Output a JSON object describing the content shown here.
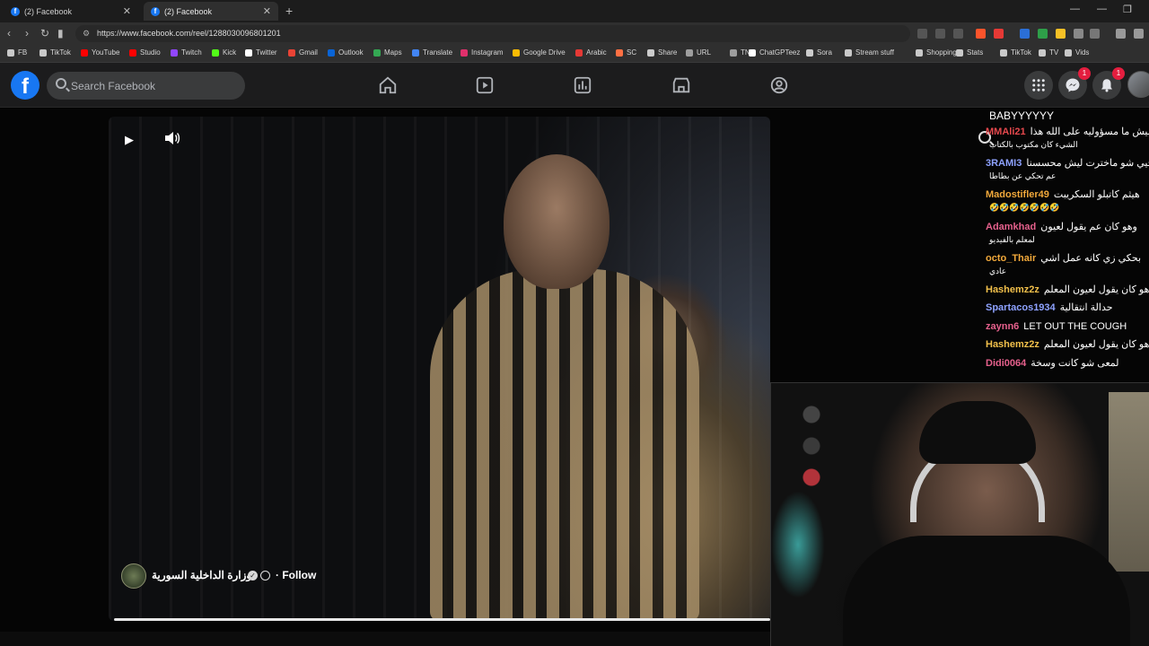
{
  "browser": {
    "tabs": [
      {
        "title": "(2) Facebook"
      },
      {
        "title": "(2) Facebook"
      }
    ],
    "new_tab_glyph": "+",
    "close_glyph": "✕",
    "url": "https://www.facebook.com/reel/1288030096801201"
  },
  "bookmarks": [
    {
      "label": "FB",
      "icon": "folder-icon",
      "color": "#c9c9c9"
    },
    {
      "label": "TikTok",
      "icon": "folder-icon",
      "color": "#c9c9c9"
    },
    {
      "label": "YouTube",
      "icon": "youtube-icon",
      "color": "#ff0000"
    },
    {
      "label": "Studio",
      "icon": "youtube-icon",
      "color": "#ff0000"
    },
    {
      "label": "Twitch",
      "icon": "twitch-icon",
      "color": "#9146ff"
    },
    {
      "label": "Kick",
      "icon": "kick-icon",
      "color": "#53fc18"
    },
    {
      "label": "Twitter",
      "icon": "x-icon",
      "color": "#ffffff"
    },
    {
      "label": "Gmail",
      "icon": "gmail-icon",
      "color": "#ea4335"
    },
    {
      "label": "Outlook",
      "icon": "outlook-icon",
      "color": "#0a64d6"
    },
    {
      "label": "Maps",
      "icon": "maps-icon",
      "color": "#34a853"
    },
    {
      "label": "Translate",
      "icon": "translate-icon",
      "color": "#4285f4"
    },
    {
      "label": "Instagram",
      "icon": "instagram-icon",
      "color": "#e1306c"
    },
    {
      "label": "Google Drive",
      "icon": "drive-icon",
      "color": "#fbbc04"
    },
    {
      "label": "Arabic",
      "icon": "arabic-icon",
      "color": "#e53935"
    },
    {
      "label": "SC",
      "icon": "sc-icon",
      "color": "#ff7043"
    },
    {
      "label": "Share",
      "icon": "share-icon",
      "color": "#cccccc"
    },
    {
      "label": "URL",
      "icon": "url-icon",
      "color": "#9e9e9e"
    },
    {
      "label": "TN",
      "icon": "tn-icon",
      "color": "#9e9e9e"
    },
    {
      "label": "ChatGPTeez",
      "icon": "chatgpt-icon",
      "color": "#ffffff"
    },
    {
      "label": "Sora",
      "icon": "sora-icon",
      "color": "#cccccc"
    },
    {
      "label": "Stream stuff",
      "icon": "folder-icon",
      "color": "#c9c9c9"
    },
    {
      "label": "Shopping",
      "icon": "folder-icon",
      "color": "#c9c9c9"
    },
    {
      "label": "Stats",
      "icon": "folder-icon",
      "color": "#c9c9c9"
    },
    {
      "label": "TikTok",
      "icon": "folder-icon",
      "color": "#c9c9c9"
    },
    {
      "label": "TV",
      "icon": "folder-icon",
      "color": "#c9c9c9"
    },
    {
      "label": "Vids",
      "icon": "folder-icon",
      "color": "#c9c9c9"
    }
  ],
  "facebook": {
    "logo": "f",
    "search_placeholder": "Search Facebook",
    "nav": [
      "home-icon",
      "video-icon",
      "gaming-icon",
      "marketplace-icon",
      "groups-icon"
    ],
    "menu_icon": "grid-menu-icon",
    "messenger_badge": "1",
    "notifications_badge": "1"
  },
  "reel": {
    "page_name": "وزارة الداخلية السورية",
    "follow_label": "· Follow",
    "play_icon": "▶",
    "sound_icon": "speaker-icon"
  },
  "chat": [
    {
      "user": "",
      "color": "#ffffff",
      "msg": "BABYYYYYY",
      "wrap": ""
    },
    {
      "user": "MMAli21",
      "color": "#e5484d",
      "msg": "ليش ما مسؤوليه على الله هذا",
      "wrap": "الشيء كان مكتوب بالكتاب"
    },
    {
      "user": "3RAMI3",
      "color": "#8ea2ff",
      "msg": "خيي شو ماخترت ليش محسسنا",
      "wrap": "عم تحكي عن بطاطا"
    },
    {
      "user": "Madostifler49",
      "color": "#f2a93b",
      "msg": "هيثم كاتبلو السكريبت",
      "wrap": "🤣🤣🤣🤣🤣🤣🤣"
    },
    {
      "user": "Adamkhad",
      "color": "#e5608c",
      "msg": "وهو كان عم يقول لعيون",
      "wrap": "لمعلم بالفيديو"
    },
    {
      "user": "octo_Thair",
      "color": "#f2a93b",
      "msg": "بحكي زي كانه عمل اشي",
      "wrap": "عادي"
    },
    {
      "user": "Hashemz2z",
      "color": "#f2c04b",
      "msg": "هو كان يقول لعيون المعلم",
      "wrap": ""
    },
    {
      "user": "Spartacos1934",
      "color": "#8ea2ff",
      "msg": "حدالة انتقالية",
      "wrap": ""
    },
    {
      "user": "zaynn6",
      "color": "#e5608c",
      "msg": "LET OUT THE COUGH",
      "wrap": ""
    },
    {
      "user": "Hashemz2z",
      "color": "#f2c04b",
      "msg": "هو كان يقول لعيون المعلم",
      "wrap": ""
    },
    {
      "user": "Didi0064",
      "color": "#e5608c",
      "msg": "لمعى شو كانت وسخة",
      "wrap": ""
    }
  ],
  "colors": {
    "fb_blue": "#1877f2",
    "badge_red": "#e41e3f"
  }
}
